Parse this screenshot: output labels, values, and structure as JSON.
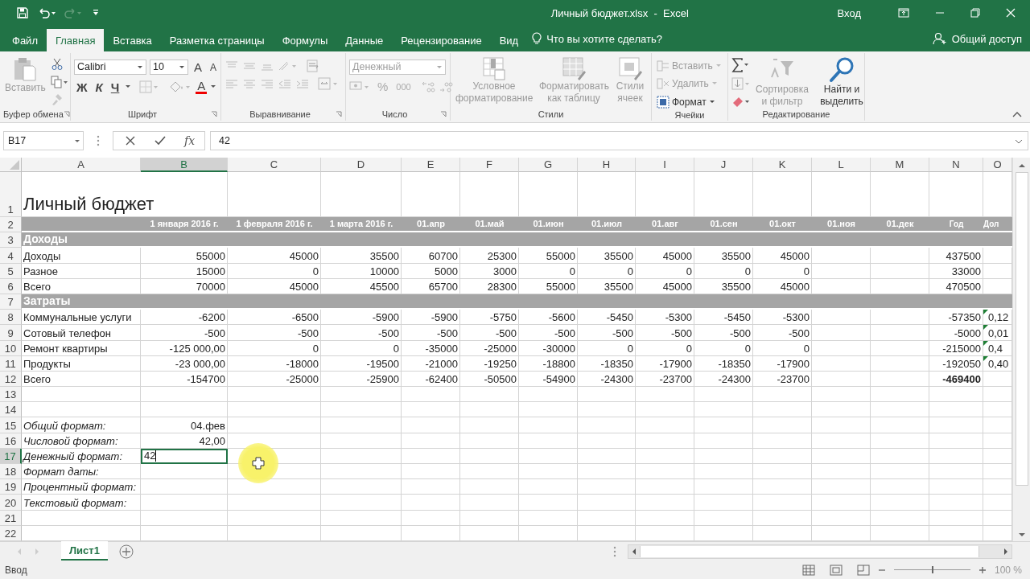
{
  "window": {
    "title": "Личный бюджет.xlsx  -  Excel",
    "sign_in": "Вход"
  },
  "menu_tabs": [
    {
      "label": "Файл",
      "selected": false
    },
    {
      "label": "Главная",
      "selected": true
    },
    {
      "label": "Вставка",
      "selected": false
    },
    {
      "label": "Разметка страницы",
      "selected": false
    },
    {
      "label": "Формулы",
      "selected": false
    },
    {
      "label": "Данные",
      "selected": false
    },
    {
      "label": "Рецензирование",
      "selected": false
    },
    {
      "label": "Вид",
      "selected": false
    }
  ],
  "tell_me": {
    "placeholder": "Что вы хотите сделать?"
  },
  "share": "Общий доступ",
  "ribbon": {
    "clipboard": {
      "label": "Буфер обмена",
      "paste": {
        "label": "Вставить",
        "disabled": true
      }
    },
    "font": {
      "label": "Шрифт",
      "family": "Calibri",
      "size": "10",
      "grow": "A",
      "shrink": "A",
      "bold": "Ж",
      "italic": "К",
      "underline": "Ч",
      "font_color_button": "A"
    },
    "alignment": {
      "label": "Выравнивание"
    },
    "number": {
      "label": "Число",
      "format": "Денежный",
      "disabled": true,
      "percent": "%",
      "thousands": "000"
    },
    "styles": {
      "label": "Стили",
      "buttons": [
        {
          "kind": "conditional",
          "label": "Условное форматирование",
          "disabled": true
        },
        {
          "kind": "table",
          "label": "Форматировать как таблицу",
          "disabled": true
        },
        {
          "kind": "cellstyles",
          "label": "Стили ячеек",
          "disabled": true
        }
      ]
    },
    "cells": {
      "label": "Ячейки",
      "buttons": [
        {
          "kind": "insert",
          "label": "Вставить",
          "disabled": true
        },
        {
          "kind": "delete",
          "label": "Удалить",
          "disabled": true
        },
        {
          "kind": "format",
          "label": "Формат",
          "disabled": false
        }
      ]
    },
    "editing": {
      "label": "Редактирование",
      "buttons": [
        {
          "kind": "sort",
          "label": "Сортировка и фильтр",
          "disabled": true
        },
        {
          "kind": "find",
          "label": "Найти и выделить",
          "disabled": false
        }
      ]
    }
  },
  "formula_bar": {
    "name_box": "B17",
    "function_label": "fx",
    "value": "42"
  },
  "sheet": {
    "columns": [
      {
        "label": "A",
        "selected": false
      },
      {
        "label": "B",
        "selected": true
      },
      {
        "label": "C",
        "selected": false
      },
      {
        "label": "D",
        "selected": false
      },
      {
        "label": "E",
        "selected": false
      },
      {
        "label": "F",
        "selected": false
      },
      {
        "label": "G",
        "selected": false
      },
      {
        "label": "H",
        "selected": false
      },
      {
        "label": "I",
        "selected": false
      },
      {
        "label": "J",
        "selected": false
      },
      {
        "label": "K",
        "selected": false
      },
      {
        "label": "L",
        "selected": false
      },
      {
        "label": "M",
        "selected": false
      },
      {
        "label": "N",
        "selected": false
      },
      {
        "label": "O",
        "selected": false
      }
    ],
    "rows": [
      {
        "number": "1",
        "kind": "title",
        "selected": false,
        "cells": [
          "Личный бюджет"
        ]
      },
      {
        "number": "2",
        "kind": "header",
        "selected": false,
        "cells": [
          null,
          "1 января 2016 г.",
          "1 февраля 2016 г.",
          "1 марта 2016 г.",
          "01.апр",
          "01.май",
          "01.июн",
          "01.июл",
          "01.авг",
          "01.сен",
          "01.окт",
          "01.ноя",
          "01.дек",
          {
            "text": "Год",
            "small": true
          },
          {
            "text": "Дол",
            "small": true
          }
        ]
      },
      {
        "number": "3",
        "kind": "section",
        "selected": false,
        "cells": [
          "Доходы"
        ]
      },
      {
        "number": "4",
        "kind": "data",
        "selected": false,
        "cells": [
          "Доходы",
          "55000",
          "45000",
          "35500",
          "60700",
          "25300",
          "55000",
          "35500",
          "45000",
          "35500",
          "45000",
          null,
          null,
          "437500",
          null
        ]
      },
      {
        "number": "5",
        "kind": "data",
        "selected": false,
        "cells": [
          "Разное",
          "15000",
          "0",
          "10000",
          "5000",
          "3000",
          "0",
          "0",
          "0",
          "0",
          "0",
          null,
          null,
          "33000",
          null
        ]
      },
      {
        "number": "6",
        "kind": "data",
        "selected": false,
        "cells": [
          "Всего",
          "70000",
          "45000",
          "45500",
          "65700",
          "28300",
          "55000",
          "35500",
          "45000",
          "35500",
          "45000",
          null,
          null,
          "470500",
          null
        ]
      },
      {
        "number": "7",
        "kind": "section",
        "selected": false,
        "cells": [
          "Затраты"
        ]
      },
      {
        "number": "8",
        "kind": "data",
        "selected": false,
        "cells": [
          "Коммунальные услуги",
          "-6200",
          "-6500",
          "-5900",
          "-5900",
          "-5750",
          "-5600",
          "-5450",
          "-5300",
          "-5450",
          "-5300",
          null,
          null,
          "-57350",
          {
            "text": "0,12",
            "flag": true
          }
        ]
      },
      {
        "number": "9",
        "kind": "data",
        "selected": false,
        "cells": [
          "Сотовый телефон",
          "-500",
          "-500",
          "-500",
          "-500",
          "-500",
          "-500",
          "-500",
          "-500",
          "-500",
          "-500",
          null,
          null,
          "-5000",
          {
            "text": "0,01",
            "flag": true
          }
        ]
      },
      {
        "number": "10",
        "kind": "data",
        "selected": false,
        "cells": [
          "Ремонт квартиры",
          "-125 000,00",
          "0",
          "0",
          "-35000",
          "-25000",
          "-30000",
          "0",
          "0",
          "0",
          "0",
          null,
          null,
          "-215000",
          {
            "text": "0,4",
            "flag": true
          }
        ]
      },
      {
        "number": "11",
        "kind": "data",
        "selected": false,
        "cells": [
          "Продукты",
          "-23 000,00",
          "-18000",
          "-19500",
          "-21000",
          "-19250",
          "-18800",
          "-18350",
          "-17900",
          "-18350",
          "-17900",
          null,
          null,
          "-192050",
          {
            "text": "0,40",
            "flag": true
          }
        ]
      },
      {
        "number": "12",
        "kind": "data",
        "selected": false,
        "cells": [
          "Всего",
          "-154700",
          "-25000",
          "-25900",
          "-62400",
          "-50500",
          "-54900",
          "-24300",
          "-23700",
          "-24300",
          "-23700",
          null,
          null,
          {
            "text": "-469400",
            "bold": true
          },
          null
        ]
      },
      {
        "number": "13",
        "kind": "data",
        "selected": false,
        "cells": []
      },
      {
        "number": "14",
        "kind": "data",
        "selected": false,
        "cells": []
      },
      {
        "number": "15",
        "kind": "label",
        "selected": false,
        "cells": [
          "Общий формат:",
          "04.фев"
        ]
      },
      {
        "number": "16",
        "kind": "label",
        "selected": false,
        "cells": [
          "Числовой формат:",
          "42,00"
        ]
      },
      {
        "number": "17",
        "kind": "label",
        "selected": true,
        "cells": [
          "Денежный формат:",
          {
            "text": "42",
            "editing": true
          }
        ]
      },
      {
        "number": "18",
        "kind": "label",
        "selected": false,
        "cells": [
          "Формат даты:"
        ]
      },
      {
        "number": "19",
        "kind": "label",
        "selected": false,
        "cells": [
          "Процентный формат:"
        ]
      },
      {
        "number": "20",
        "kind": "label",
        "selected": false,
        "cells": [
          "Текстовый формат:"
        ]
      },
      {
        "number": "21",
        "kind": "data",
        "selected": false,
        "cells": []
      },
      {
        "number": "22",
        "kind": "data",
        "selected": false,
        "cells": []
      }
    ]
  },
  "sheet_tabs": [
    {
      "label": "Лист1",
      "selected": true
    }
  ],
  "status_bar": {
    "mode": "Ввод",
    "zoom": "100 %",
    "zoom_slider": {
      "level": 0.5
    }
  }
}
